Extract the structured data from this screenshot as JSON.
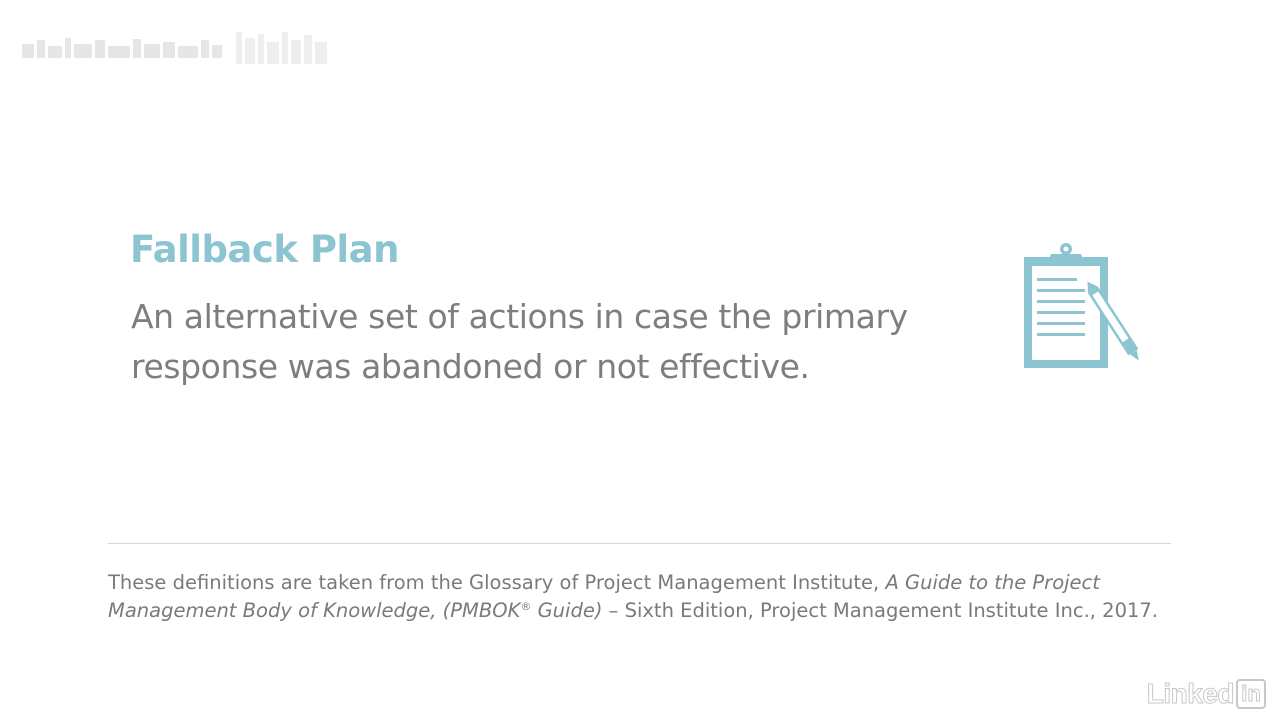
{
  "colors": {
    "accent": "#8cc5d1",
    "body_text": "#7e7e7e",
    "divider": "#d6d6d6"
  },
  "header": {
    "logo_icon": "faint-brand-logo-icon"
  },
  "term": {
    "title": "Fallback Plan",
    "definition": "An alternative set of actions in case the primary response was abandoned or not effective.",
    "icon": "clipboard-pen-icon"
  },
  "citation": {
    "intro": "These definitions are taken from the Glossary of Project Management Institute, ",
    "book_title_part1": "A Guide to the Project Management Body of Knowledge, (PMBOK",
    "registered_mark": "®",
    "book_title_part2": " Guide)",
    "edition_details": " – Sixth Edition, Project Management Institute Inc., 2017."
  },
  "watermark": {
    "text": "Linked",
    "box_text": "in"
  }
}
